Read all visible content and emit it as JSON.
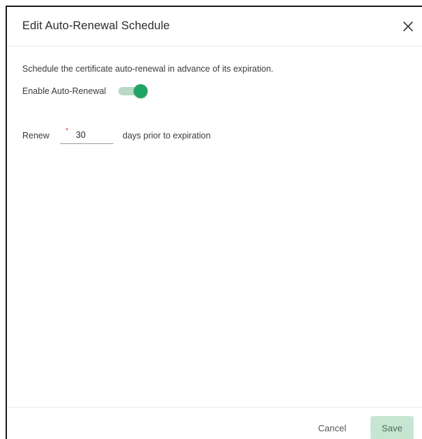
{
  "dialog": {
    "title": "Edit Auto-Renewal Schedule",
    "close_icon": "close-icon"
  },
  "body": {
    "description": "Schedule the certificate auto-renewal in advance of its expiration.",
    "toggle_label": "Enable Auto-Renewal",
    "toggle_enabled": true,
    "renew_label": "Renew",
    "required_mark": "*",
    "days_value": "30",
    "suffix_label": "days prior to expiration"
  },
  "footer": {
    "cancel_label": "Cancel",
    "save_label": "Save"
  },
  "colors": {
    "accent": "#1fa463",
    "toggle_track": "#b9d9c4",
    "save_button_bg": "#c7e6d2",
    "required": "#e5493a"
  }
}
